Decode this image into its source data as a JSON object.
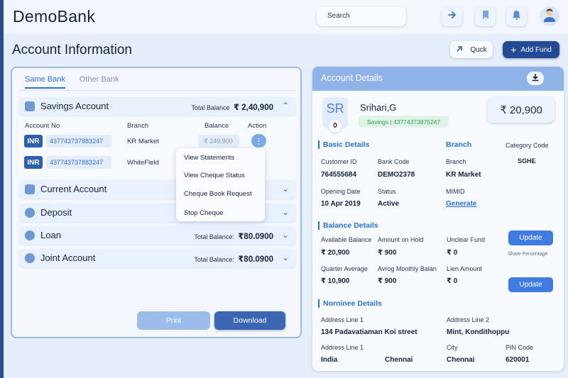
{
  "app": {
    "title": "DemoBank"
  },
  "header": {
    "search_placeholder": "Search"
  },
  "page": {
    "title": "Account Information"
  },
  "actions": {
    "quick_label": "Quck",
    "add_fund_label": "Add Fund"
  },
  "tabs": [
    {
      "label": "Same Bank",
      "active": true
    },
    {
      "label": "Other Bank",
      "active": false
    }
  ],
  "accounts": {
    "savings": {
      "name": "Savings Account",
      "total_label": "Total Balance",
      "total": "₹ 2,40,900"
    },
    "current": {
      "name": "Current Account"
    },
    "deposit": {
      "name": "Deposit"
    },
    "loan": {
      "name": "Loan",
      "total_label": "Total Balance:",
      "total": "₹80.0900"
    },
    "joint": {
      "name": "Joint Account",
      "total_label": "Total Balance:",
      "total": "₹80.0900"
    }
  },
  "savings_table": {
    "headers": {
      "account_no": "Account No",
      "branch": "Branch",
      "balance": "Balance",
      "action": "Action"
    },
    "rows": [
      {
        "currency": "INR",
        "account_no": "437743737883247",
        "branch": "KR Market",
        "balance": "₹ 249,900"
      },
      {
        "currency": "INR",
        "account_no": "437743737883247",
        "branch": "WhiteFleld",
        "balance": ""
      }
    ]
  },
  "action_menu": {
    "items": [
      "View Statements",
      "View Cheque Status",
      "Cheque Book Request",
      "Stop Cheque"
    ]
  },
  "footer_buttons": {
    "print": "Print",
    "download": "Download"
  },
  "details": {
    "title": "Account Details",
    "initials": "SR",
    "badge_count": "0",
    "customer_name": "Srihari,G",
    "account_tag": "Savings | 43774373875247",
    "balance": "₹ 20,900",
    "basic": {
      "title": "Basic Details",
      "branch_heading": "Branch",
      "category_code_label": "Category Code",
      "category_code": "SGHE",
      "customer_id_label": "Customer ID",
      "customer_id": "764555684",
      "bank_code_label": "Bank Code",
      "bank_code": "DEMO2378",
      "branch_label": "Branch",
      "branch": "KR Market",
      "opening_date_label": "Opening Date",
      "opening_date": "10 Apr 2019",
      "status_label": "Status",
      "status": "Active",
      "mimid_label": "MIMID",
      "mimid_link": "Generate"
    },
    "balance_details": {
      "title": "Balance Details",
      "available_label": "Available Balance",
      "available": "₹ 20,900",
      "on_hold_label": "Amount on Hold",
      "on_hold": "₹ 900",
      "unclear_label": "Unclear Fund",
      "unclear": "₹ 0",
      "quarter_label": "Quarter Average",
      "quarter": "₹ 10,900",
      "monthly_label": "Avrog Monthly Balan",
      "monthly": "₹ 900",
      "lien_label": "Lien Amount",
      "lien": "₹ 0",
      "update_label": "Update",
      "share_note": "Share Percentage"
    },
    "nominee": {
      "title": "Norninee Details",
      "addr1_label": "Address Line 1",
      "addr1": "134 Padavatiaman Koi street",
      "addr2_label": "Address Line 2",
      "addr2": "Mint, Kondithoppu",
      "addr1b_label": "Address Line 1",
      "country": "India",
      "state": "Chennai",
      "city_label": "City",
      "city": "Chennai",
      "pin_label": "PIN Code",
      "pin": "620001"
    }
  }
}
